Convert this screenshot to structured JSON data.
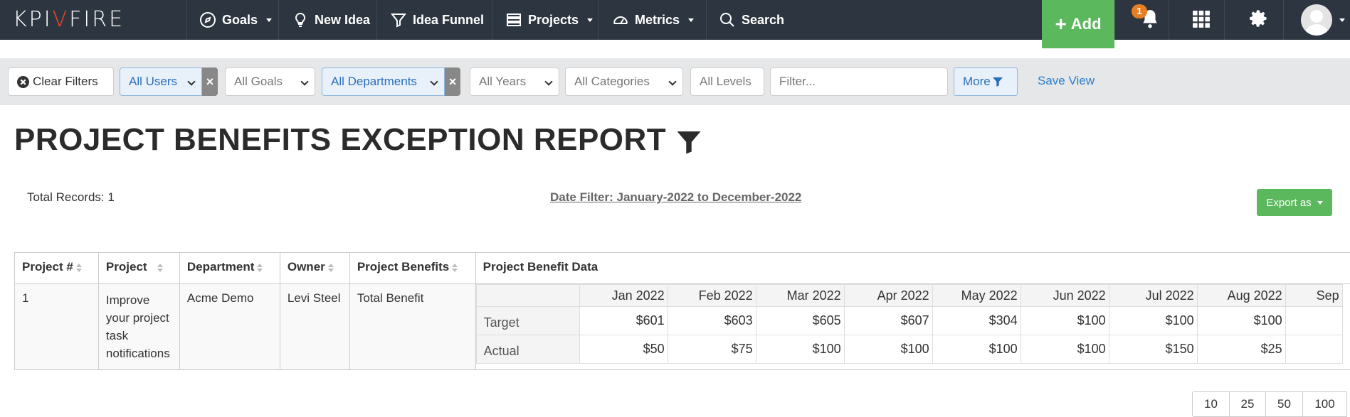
{
  "nav": {
    "logo_left": "KPI",
    "logo_v": "V",
    "logo_right": "FIRE",
    "goals": "Goals",
    "new_idea": "New Idea",
    "idea_funnel": "Idea Funnel",
    "projects": "Projects",
    "metrics": "Metrics",
    "search": "Search",
    "add": "Add",
    "notification_count": "1"
  },
  "filters": {
    "clear": "Clear Filters",
    "users": "All Users",
    "goals": "All Goals",
    "departments": "All Departments",
    "years": "All Years",
    "categories": "All Categories",
    "levels": "All Levels",
    "filter_placeholder": "Filter...",
    "more": "More",
    "save_view": "Save View",
    "remove_x": "×"
  },
  "report": {
    "title": "PROJECT BENEFITS EXCEPTION REPORT",
    "total_records": "Total Records: 1",
    "date_filter": "Date Filter: January-2022 to December-2022",
    "export": "Export as"
  },
  "table": {
    "headers": [
      "Project #",
      "Project",
      "Department",
      "Owner",
      "Project Benefits",
      "Project Benefit Data"
    ],
    "row": {
      "number": "1",
      "project": "Improve your project task notifications",
      "department": "Acme Demo",
      "owner": "Levi Steel",
      "benefits": "Total Benefit"
    },
    "months": [
      "Jan 2022",
      "Feb 2022",
      "Mar 2022",
      "Apr 2022",
      "May 2022",
      "Jun 2022",
      "Jul 2022",
      "Aug 2022",
      "Sep"
    ],
    "target_label": "Target",
    "actual_label": "Actual",
    "target": [
      "$601",
      "$603",
      "$605",
      "$607",
      "$304",
      "$100",
      "$100",
      "$100",
      ""
    ],
    "actual": [
      "$50",
      "$75",
      "$100",
      "$100",
      "$100",
      "$100",
      "$150",
      "$25",
      ""
    ]
  },
  "pagination": [
    "10",
    "25",
    "50",
    "100"
  ]
}
